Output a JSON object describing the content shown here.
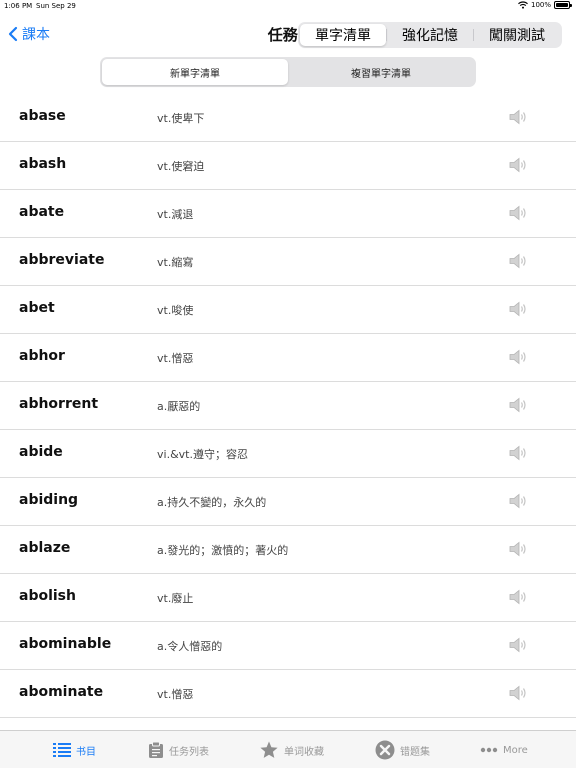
{
  "status": {
    "time": "1:06 PM",
    "date": "Sun Sep 29",
    "battery": "100%",
    "battery_level": 1.0
  },
  "nav": {
    "back_label": "課本",
    "title": "任務1"
  },
  "top_segments": [
    {
      "label": "單字清單",
      "active": true
    },
    {
      "label": "強化記憶",
      "active": false
    },
    {
      "label": "闖關測試",
      "active": false
    }
  ],
  "sub_segments": [
    {
      "label": "新單字清單",
      "active": true
    },
    {
      "label": "複習單字清單",
      "active": false
    }
  ],
  "words": [
    {
      "word": "abase",
      "definition": "vt.使卑下"
    },
    {
      "word": "abash",
      "definition": "vt.使窘迫"
    },
    {
      "word": "abate",
      "definition": "vt.減退"
    },
    {
      "word": "abbreviate",
      "definition": "vt.縮寫"
    },
    {
      "word": "abet",
      "definition": "vt.唆使"
    },
    {
      "word": "abhor",
      "definition": "vt.憎惡"
    },
    {
      "word": "abhorrent",
      "definition": "a.厭惡的"
    },
    {
      "word": "abide",
      "definition": "vi.&vt.遵守；容忍"
    },
    {
      "word": "abiding",
      "definition": "a.持久不變的，永久的"
    },
    {
      "word": "ablaze",
      "definition": "a.發光的；激憤的；著火的"
    },
    {
      "word": "abolish",
      "definition": "vt.廢止"
    },
    {
      "word": "abominable",
      "definition": "a.令人憎惡的"
    },
    {
      "word": "abominate",
      "definition": "vt.憎惡"
    }
  ],
  "tabs": [
    {
      "label": "书目",
      "icon": "list-icon",
      "active": true
    },
    {
      "label": "任务列表",
      "icon": "clipboard-icon",
      "active": false
    },
    {
      "label": "单词收藏",
      "icon": "star-icon",
      "active": false
    },
    {
      "label": "错题集",
      "icon": "x-circle-icon",
      "active": false
    },
    {
      "label": "More",
      "icon": "more-dots-icon",
      "active": false
    }
  ],
  "colors": {
    "accent": "#1a7cf5",
    "inactive": "#999999"
  }
}
